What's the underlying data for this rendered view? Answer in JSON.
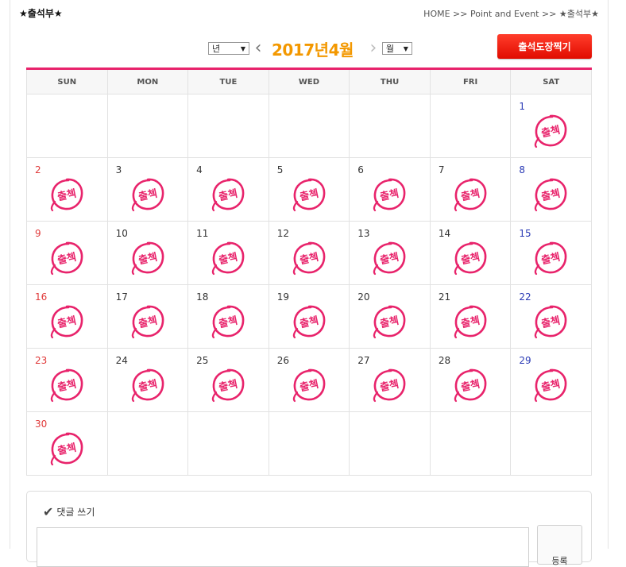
{
  "page": {
    "title": "★출석부★",
    "breadcrumb": "HOME >> Point and Event >> ★출석부★"
  },
  "nav": {
    "year_select": "년",
    "month_select": "월",
    "current_month": "2017년4월",
    "prev_icon": "chevron-left-icon",
    "next_icon": "chevron-right-icon"
  },
  "attend_button": "출석도장찍기",
  "calendar": {
    "weekdays": [
      "SUN",
      "MON",
      "TUE",
      "WED",
      "THU",
      "FRI",
      "SAT"
    ],
    "stamp_text": "출첵",
    "stamp_color": "#e8236b",
    "weeks": [
      [
        null,
        null,
        null,
        null,
        null,
        null,
        "1"
      ],
      [
        "2",
        "3",
        "4",
        "5",
        "6",
        "7",
        "8"
      ],
      [
        "9",
        "10",
        "11",
        "12",
        "13",
        "14",
        "15"
      ],
      [
        "16",
        "17",
        "18",
        "19",
        "20",
        "21",
        "22"
      ],
      [
        "23",
        "24",
        "25",
        "26",
        "27",
        "28",
        "29"
      ],
      [
        "30",
        null,
        null,
        null,
        null,
        null,
        null
      ]
    ]
  },
  "comment": {
    "title": "댓글 쓰기",
    "submit": "등록"
  }
}
